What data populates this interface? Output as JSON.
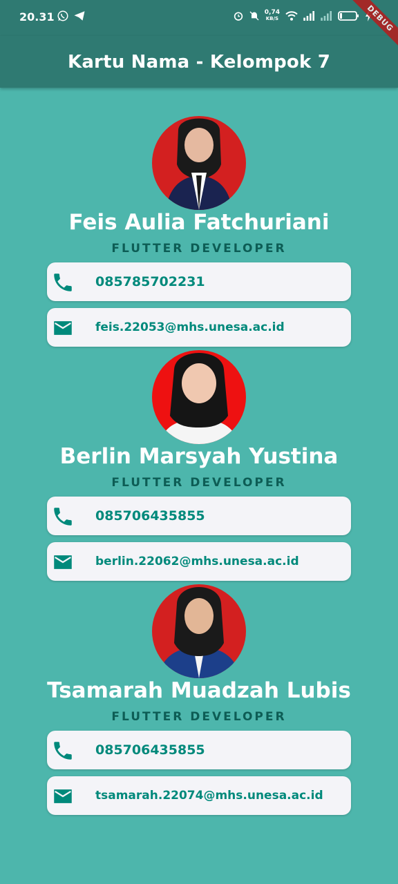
{
  "status_bar": {
    "time": "20.31",
    "net_speed_value": "0,74",
    "net_speed_unit": "KB/S"
  },
  "app_bar": {
    "title": "Kartu Nama - Kelompok 7"
  },
  "debug_banner": "DEBUG",
  "people": [
    {
      "name": "Feis Aulia Fatchuriani",
      "role": "FLUTTER DEVELOPER",
      "phone": "085785702231",
      "email": "feis.22053@mhs.unesa.ac.id",
      "photo_bg": "#d32020"
    },
    {
      "name": "Berlin Marsyah Yustina",
      "role": "FLUTTER DEVELOPER",
      "phone": "085706435855",
      "email": "berlin.22062@mhs.unesa.ac.id",
      "photo_bg": "#ee1111"
    },
    {
      "name": "Tsamarah Muadzah Lubis",
      "role": "FLUTTER DEVELOPER",
      "phone": "085706435855",
      "email": "tsamarah.22074@mhs.unesa.ac.id",
      "photo_bg": "#d32020"
    }
  ],
  "colors": {
    "background": "#4db6ac",
    "app_bar": "#2f7a72",
    "accent": "#00897b",
    "role_text": "#0d5d55",
    "card": "#f4f4f8"
  },
  "icons": {
    "phone": "phone-icon",
    "email": "mail-icon"
  }
}
